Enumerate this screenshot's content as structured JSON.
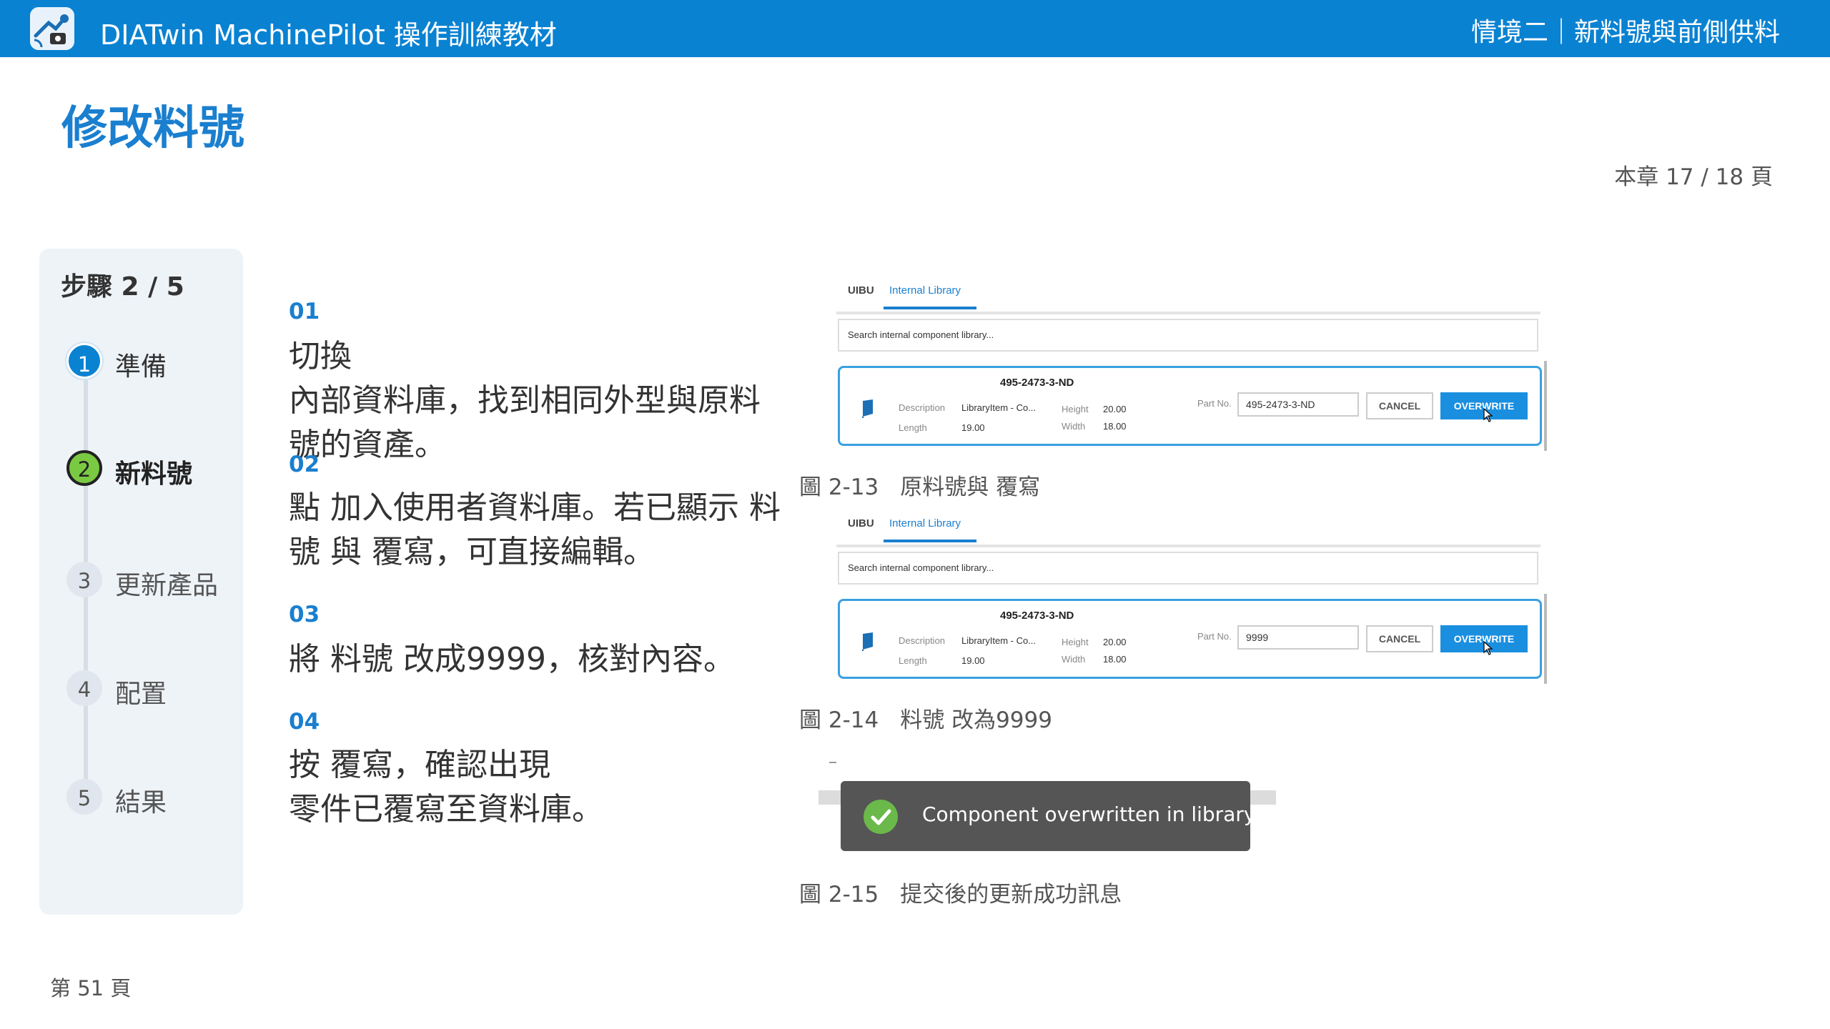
{
  "header": {
    "app_title": "DIATwin MachinePilot 操作訓練教材",
    "section": "情境二｜新料號與前側供料",
    "brand_color": "#0a82d2"
  },
  "page": {
    "title": "修改料號",
    "chapter_page": "本章 17 / 18 頁",
    "footer_page": "第 51 頁"
  },
  "steps": {
    "title": "步驟 2 / 5",
    "items": [
      {
        "num": "1",
        "label": "準備",
        "state": "done"
      },
      {
        "num": "2",
        "label": "新料號",
        "state": "active"
      },
      {
        "num": "3",
        "label": "更新產品",
        "state": "todo"
      },
      {
        "num": "4",
        "label": "配置",
        "state": "todo"
      },
      {
        "num": "5",
        "label": "結果",
        "state": "todo"
      }
    ]
  },
  "instructions": [
    {
      "num": "01",
      "text": "切換\n內部資料庫，找到相同外型與原料號的資產。"
    },
    {
      "num": "02",
      "text": "點 加入使用者資料庫。若已顯示 料號 與 覆寫，可直接編輯。"
    },
    {
      "num": "03",
      "text": "將 料號 改成9999，核對內容。"
    },
    {
      "num": "04",
      "text": "按 覆寫，確認出現\n零件已覆寫至資料庫。"
    }
  ],
  "screenshots": [
    {
      "tab_uibu": "UIBU",
      "tab_library": "Internal Library",
      "search_placeholder": "Search internal component library...",
      "card_title": "495-2473-3-ND",
      "desc_label": "Description",
      "desc_value": "LibraryItem - Co...",
      "length_label": "Length",
      "length_value": "19.00",
      "height_label": "Height",
      "height_value": "20.00",
      "width_label": "Width",
      "width_value": "18.00",
      "partno_label": "Part No.",
      "partno_value": "495-2473-3-ND",
      "cancel_label": "CANCEL",
      "overwrite_label": "OVERWRITE",
      "caption_num": "圖 2-13",
      "caption_text": "原料號與 覆寫"
    },
    {
      "tab_uibu": "UIBU",
      "tab_library": "Internal Library",
      "search_placeholder": "Search internal component library...",
      "card_title": "495-2473-3-ND",
      "desc_label": "Description",
      "desc_value": "LibraryItem - Co...",
      "length_label": "Length",
      "length_value": "19.00",
      "height_label": "Height",
      "height_value": "20.00",
      "width_label": "Width",
      "width_value": "18.00",
      "partno_label": "Part No.",
      "partno_value": "9999",
      "cancel_label": "CANCEL",
      "overwrite_label": "OVERWRITE",
      "caption_num": "圖 2-14",
      "caption_text": "料號 改為9999"
    }
  ],
  "toast": {
    "message": "Component overwritten in library.",
    "caption_num": "圖 2-15",
    "caption_text": "提交後的更新成功訊息"
  }
}
